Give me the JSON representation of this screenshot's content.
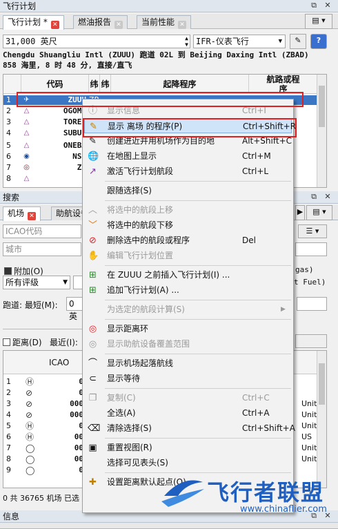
{
  "flightplan_panel": {
    "title": "飞行计划",
    "tabs": [
      {
        "label": "飞行计划 *"
      },
      {
        "label": "燃油报告"
      },
      {
        "label": "当前性能"
      }
    ],
    "altitude_value": "31,000 英尺",
    "flight_type_value": "IFR-仪表飞行",
    "route_summary_line1": "Chengdu Shuangliu Intl (ZUUU) 跑道 02L 到 Beijing Daxing Intl (ZBAD)",
    "route_summary_line2": "858 海里, 8 时 48 分, 直接/直飞",
    "table": {
      "headers": {
        "code": "代码",
        "col2": "纬",
        "col3": "纬",
        "procedure": "起降程序",
        "airway": "航路或程序"
      },
      "rows": [
        {
          "num": "1",
          "code": "ZUUU",
          "icon": "airport",
          "extra": "ZP ..."
        },
        {
          "num": "2",
          "code": "OGOMO",
          "icon": "triangle"
        },
        {
          "num": "3",
          "code": "TOREC",
          "icon": "triangle"
        },
        {
          "num": "4",
          "code": "SUBUL",
          "icon": "triangle"
        },
        {
          "num": "5",
          "code": "ONEBA",
          "icon": "triangle"
        },
        {
          "num": "6",
          "code": "NSH",
          "icon": "vor"
        },
        {
          "num": "7",
          "code": "ZS",
          "icon": "target"
        },
        {
          "num": "8",
          "code": "",
          "icon": "triangle"
        }
      ]
    }
  },
  "context_menu": {
    "items": [
      {
        "label": "显示信息",
        "shortcut": "Ctrl+I",
        "icon": "info-icon",
        "disabled": true
      },
      {
        "label": "显示 离场 的程序(P)",
        "shortcut": "Ctrl+Shift+R",
        "icon": "procedure-icon",
        "highlight": true
      },
      {
        "label": "创建进近并用机场作为目的地",
        "shortcut": "Alt+Shift+C",
        "icon": "approach-icon"
      },
      {
        "label": "在地图上显示",
        "shortcut": "Ctrl+M",
        "icon": "globe-icon"
      },
      {
        "label": "激活飞行计划航段",
        "shortcut": "Ctrl+L",
        "icon": "activate-leg-icon"
      },
      {
        "label": "跟随选择(S)",
        "shortcut": "",
        "icon": ""
      },
      {
        "label": "将选中的航段上移",
        "shortcut": "",
        "icon": "move-up-icon",
        "disabled": true
      },
      {
        "label": "将选中的航段下移",
        "shortcut": "",
        "icon": "move-down-icon"
      },
      {
        "label": "删除选中的航段或程序",
        "shortcut": "Del",
        "icon": "delete-icon"
      },
      {
        "label": "编辑飞行计划位置",
        "shortcut": "",
        "icon": "edit-position-icon",
        "disabled": true
      },
      {
        "label": "在 ZUUU 之前插入飞行计划(I) ...",
        "shortcut": "",
        "icon": "insert-plan-icon"
      },
      {
        "label": "追加飞行计划(A) ...",
        "shortcut": "",
        "icon": "append-plan-icon"
      },
      {
        "label": "为选定的航段计算(S)",
        "shortcut": "",
        "icon": "",
        "disabled": true,
        "submenu": true
      },
      {
        "label": "显示距离环",
        "shortcut": "",
        "icon": "range-ring-icon"
      },
      {
        "label": "显示助航设备覆盖范围",
        "shortcut": "",
        "icon": "navaid-range-icon",
        "disabled": true
      },
      {
        "label": "显示机场起落航线",
        "shortcut": "",
        "icon": "traffic-pattern-icon"
      },
      {
        "label": "显示等待",
        "shortcut": "",
        "icon": "holding-icon"
      },
      {
        "label": "复制(C)",
        "shortcut": "Ctrl+C",
        "icon": "copy-icon",
        "disabled": true
      },
      {
        "label": "全选(A)",
        "shortcut": "Ctrl+A",
        "icon": ""
      },
      {
        "label": "清除选择(S)",
        "shortcut": "Ctrl+Shift+A",
        "icon": "clear-selection-icon"
      },
      {
        "label": "重置视图(R)",
        "shortcut": "",
        "icon": "reset-view-icon"
      },
      {
        "label": "选择可见表头(S)",
        "shortcut": "",
        "icon": ""
      },
      {
        "label": "设置距离默认起点(O)",
        "shortcut": "",
        "icon": "set-center-icon"
      }
    ]
  },
  "search_panel": {
    "title": "搜索",
    "tabs": [
      {
        "label": "机场"
      },
      {
        "label": "助航设备"
      }
    ],
    "icao_placeholder": "ICAO代码",
    "city_placeholder": "城市",
    "addon_label": "附加(O)",
    "rating_value": "所有评级",
    "runway_label": "跑道: 最短(M):",
    "runway_value": "0 英",
    "distance_label": "距离(D)",
    "nearest_label": "最近(I):",
    "gas_text": "gas)",
    "fuel_text": "t Fuel)",
    "results_header_icao": "ICAO",
    "result_rows": [
      {
        "num": "1",
        "code": "0",
        "right": ""
      },
      {
        "num": "2",
        "code": "0",
        "right": ""
      },
      {
        "num": "3",
        "code": "000",
        "right": "Unit"
      },
      {
        "num": "4",
        "code": "000",
        "right": "Unit"
      },
      {
        "num": "5",
        "code": "0",
        "right": "Unit"
      },
      {
        "num": "6",
        "code": "00",
        "right": "US"
      },
      {
        "num": "7",
        "code": "00",
        "right": "Unit"
      },
      {
        "num": "8",
        "code": "00",
        "right": "Unit"
      },
      {
        "num": "9",
        "code": "0",
        "right": ""
      }
    ],
    "status_text": "0 共 36765 机场 已选"
  },
  "info_panel": {
    "title": "信息"
  },
  "watermark": {
    "text": "飞行者联盟",
    "url": "www.chinaflier.com"
  },
  "colors": {
    "selection": "#3a76c4",
    "highlight_box": "#e02020",
    "menu_highlight": "#cfe3f9",
    "tab_close": "#e0443a",
    "watermark": "#1f5fbf"
  }
}
